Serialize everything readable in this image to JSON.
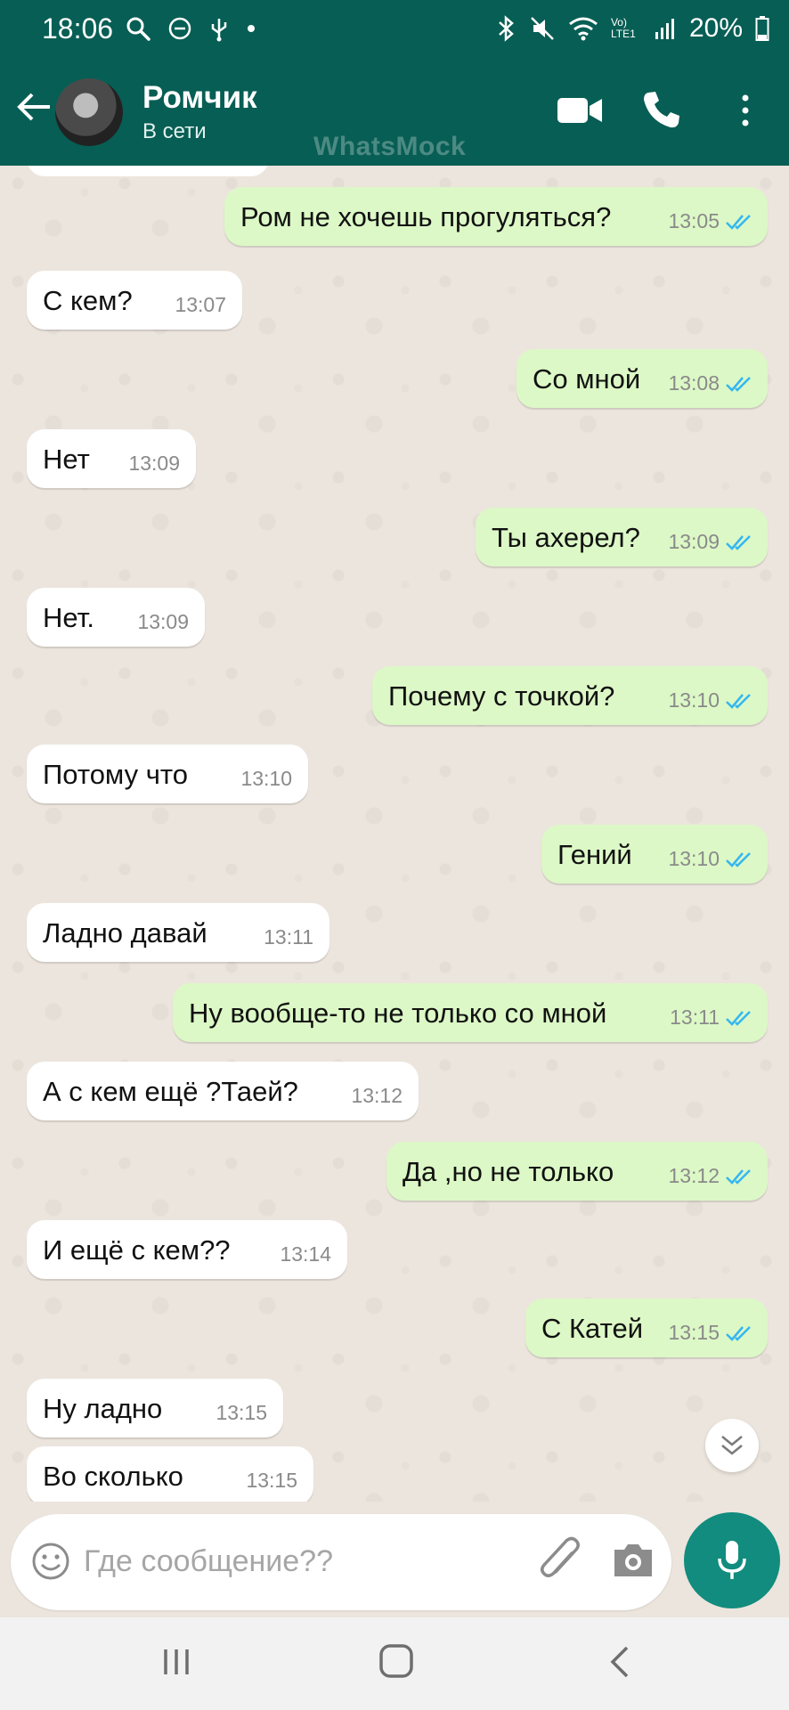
{
  "status_bar": {
    "time": "18:06",
    "network": "Vo) LTE1",
    "battery": "20%"
  },
  "header": {
    "contact_name": "Ромчик",
    "contact_status": "В сети",
    "watermark": "WhatsMock"
  },
  "messages": [
    {
      "dir": "out",
      "text": "Ром не хочешь прогуляться?",
      "time": "13:05",
      "read": true
    },
    {
      "dir": "in",
      "text": "С кем?",
      "time": "13:07"
    },
    {
      "dir": "out",
      "text": "Со мной",
      "time": "13:08",
      "read": true
    },
    {
      "dir": "in",
      "text": "Нет",
      "time": "13:09"
    },
    {
      "dir": "out",
      "text": "Ты ахерел?",
      "time": "13:09",
      "read": true
    },
    {
      "dir": "in",
      "text": "Нет.",
      "time": "13:09"
    },
    {
      "dir": "out",
      "text": "Почему с точкой?",
      "time": "13:10",
      "read": true
    },
    {
      "dir": "in",
      "text": "Потому что",
      "time": "13:10"
    },
    {
      "dir": "out",
      "text": "Гений",
      "time": "13:10",
      "read": true
    },
    {
      "dir": "in",
      "text": "Ладно давай",
      "time": "13:11"
    },
    {
      "dir": "out",
      "text": "Ну вообще-то не только со мной",
      "time": "13:11",
      "read": true
    },
    {
      "dir": "in",
      "text": "А с кем ещё ?Таей?",
      "time": "13:12"
    },
    {
      "dir": "out",
      "text": "Да ,но не только",
      "time": "13:12",
      "read": true
    },
    {
      "dir": "in",
      "text": "И ещё с кем??",
      "time": "13:14"
    },
    {
      "dir": "out",
      "text": "С Катей",
      "time": "13:15",
      "read": true
    },
    {
      "dir": "in",
      "text": "Ну ладно",
      "time": "13:15"
    },
    {
      "dir": "in",
      "text": "Во сколько",
      "time": "13:15"
    }
  ],
  "composer": {
    "placeholder": "Где сообщение??"
  },
  "colors": {
    "header": "#075e54",
    "accent": "#128c7e",
    "outgoing_bubble": "#dcf8c6",
    "incoming_bubble": "#ffffff",
    "read_ticks": "#34b7f1"
  }
}
